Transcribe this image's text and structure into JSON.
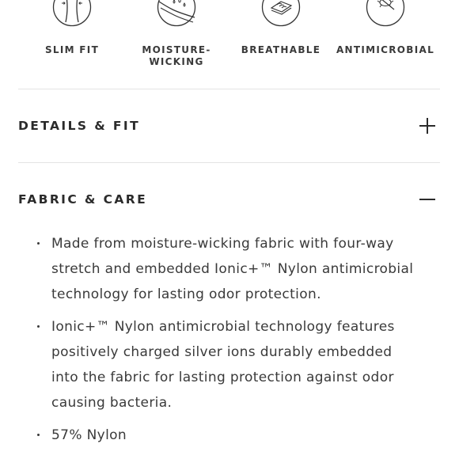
{
  "features": [
    {
      "label": "SLIM FIT",
      "icon": "slim-fit-icon"
    },
    {
      "label": "MOISTURE-\nWICKING",
      "icon": "moisture-wicking-icon"
    },
    {
      "label": "BREATHABLE",
      "icon": "breathable-icon"
    },
    {
      "label": "ANTIMICROBIAL",
      "icon": "antimicrobial-icon"
    }
  ],
  "sections": {
    "details": {
      "title": "DETAILS & FIT",
      "state": "collapsed",
      "icon": "plus-icon"
    },
    "fabric": {
      "title": "FABRIC & CARE",
      "state": "expanded",
      "icon": "minus-icon"
    }
  },
  "fabric_care": {
    "items": [
      "Made from moisture-wicking fabric with four-way stretch and embedded Ionic+™ Nylon antimicrobial technology for lasting odor protection.",
      "Ionic+™ Nylon antimicrobial technology features positively charged silver ions durably embedded into the fabric for lasting protection against odor causing bacteria.",
      "57% Nylon"
    ]
  },
  "colors": {
    "text": "#2b2b2b",
    "divider": "#e3e3e3"
  }
}
